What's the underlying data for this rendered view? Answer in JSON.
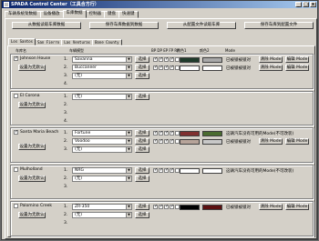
{
  "window": {
    "title": "SPADA Control Center（工具合方行）",
    "buttons": [
      "_",
      "□",
      "x"
    ]
  },
  "main_tabs": [
    "车辆系统架数据",
    "设备播放",
    "车库数据",
    "控制器",
    "键盘",
    "快速键"
  ],
  "top_buttons": [
    "从数据读取车库数据",
    "保存车库数据到数据",
    "从配置文件读取车库",
    "保存车库到配置文件"
  ],
  "sub_tabs": [
    "Los Santos",
    "San Fierro",
    "Las Venturas",
    "Bone County"
  ],
  "headers": {
    "location": "车库名",
    "model": "车辆模型",
    "flags": "BP DP EP FP RP",
    "color": "颜色1",
    "color2": "颜色2",
    "mode": "Mode"
  },
  "colors": {
    "dark_green": "#1f3b2b",
    "gray": "#a8a8a8",
    "red": "#7f3030",
    "olive": "#4a6b2f",
    "tan": "#b7a49a",
    "light_gray": "#c8c8c8",
    "black": "#000000",
    "maroon": "#5b0f0f"
  },
  "garages": [
    {
      "name": "Johnson House",
      "checked": true,
      "default_btn": "设置为无默认",
      "choose_label": "选择",
      "rows": [
        {
          "num": "1.",
          "model": "Savanna",
          "has_flags": true,
          "color1": "dark_green",
          "color2": "gray",
          "mode_text": "已被锁被锁对",
          "clear_label": "清除 Mode",
          "edit_label": "编辑 Mode"
        },
        {
          "num": "2.",
          "model": "Buccaneer",
          "has_flags": true,
          "color1": "",
          "color2": "",
          "mode_text": "已被锁被锁对",
          "clear_label": "清除 Mode",
          "edit_label": "编辑 Mode"
        },
        {
          "num": "3.",
          "model": "(无)",
          "has_flags": false
        },
        {
          "num": "4.",
          "model": ""
        }
      ]
    },
    {
      "name": "El Corona",
      "checked": false,
      "default_btn": "设置为无默认",
      "choose_label": "选择",
      "rows": [
        {
          "num": "1.",
          "model": "(无)",
          "has_flags": false
        },
        {
          "num": "2.",
          "model": ""
        },
        {
          "num": "3.",
          "model": ""
        },
        {
          "num": "4.",
          "model": ""
        }
      ]
    },
    {
      "name": "Santa Maria Beach",
      "checked": true,
      "default_btn": "设置为无默认",
      "choose_label": "选择",
      "rows": [
        {
          "num": "1.",
          "model": "Fortune",
          "has_flags": true,
          "color1": "red",
          "color2": "olive",
          "mode_text": "这辆汽车没有可用的Mode(不可改装)"
        },
        {
          "num": "2.",
          "model": "Voodoo",
          "has_flags": true,
          "color1": "tan",
          "color2": "light_gray",
          "mode_text": "已被锁被锁对",
          "clear_label": "清除 Mode",
          "edit_label": "编辑 Mode"
        },
        {
          "num": "3.",
          "model": "(无)",
          "has_flags": false
        }
      ]
    },
    {
      "name": "Mulholland",
      "checked": false,
      "default_btn": "设置为无默认",
      "choose_label": "选择",
      "rows": [
        {
          "num": "1.",
          "model": "NRG",
          "has_flags": true,
          "mode_text": "这辆汽车没有可用的Mode(不可改装)"
        },
        {
          "num": "2.",
          "model": "(无)",
          "has_flags": false
        },
        {
          "num": "3.",
          "model": ""
        }
      ]
    },
    {
      "name": "Palomino Creek",
      "checked": false,
      "default_btn": "设置为无默认",
      "choose_label": "选择",
      "rows": [
        {
          "num": "1.",
          "model": "ZR-350",
          "has_flags": true,
          "color1": "black",
          "color2": "maroon",
          "mode_text": "已被锁被锁对",
          "clear_label": "清除 Mode",
          "edit_label": "编辑 Mode"
        },
        {
          "num": "2.",
          "model": "(无)",
          "has_flags": false
        },
        {
          "num": "3.",
          "model": ""
        }
      ]
    }
  ]
}
